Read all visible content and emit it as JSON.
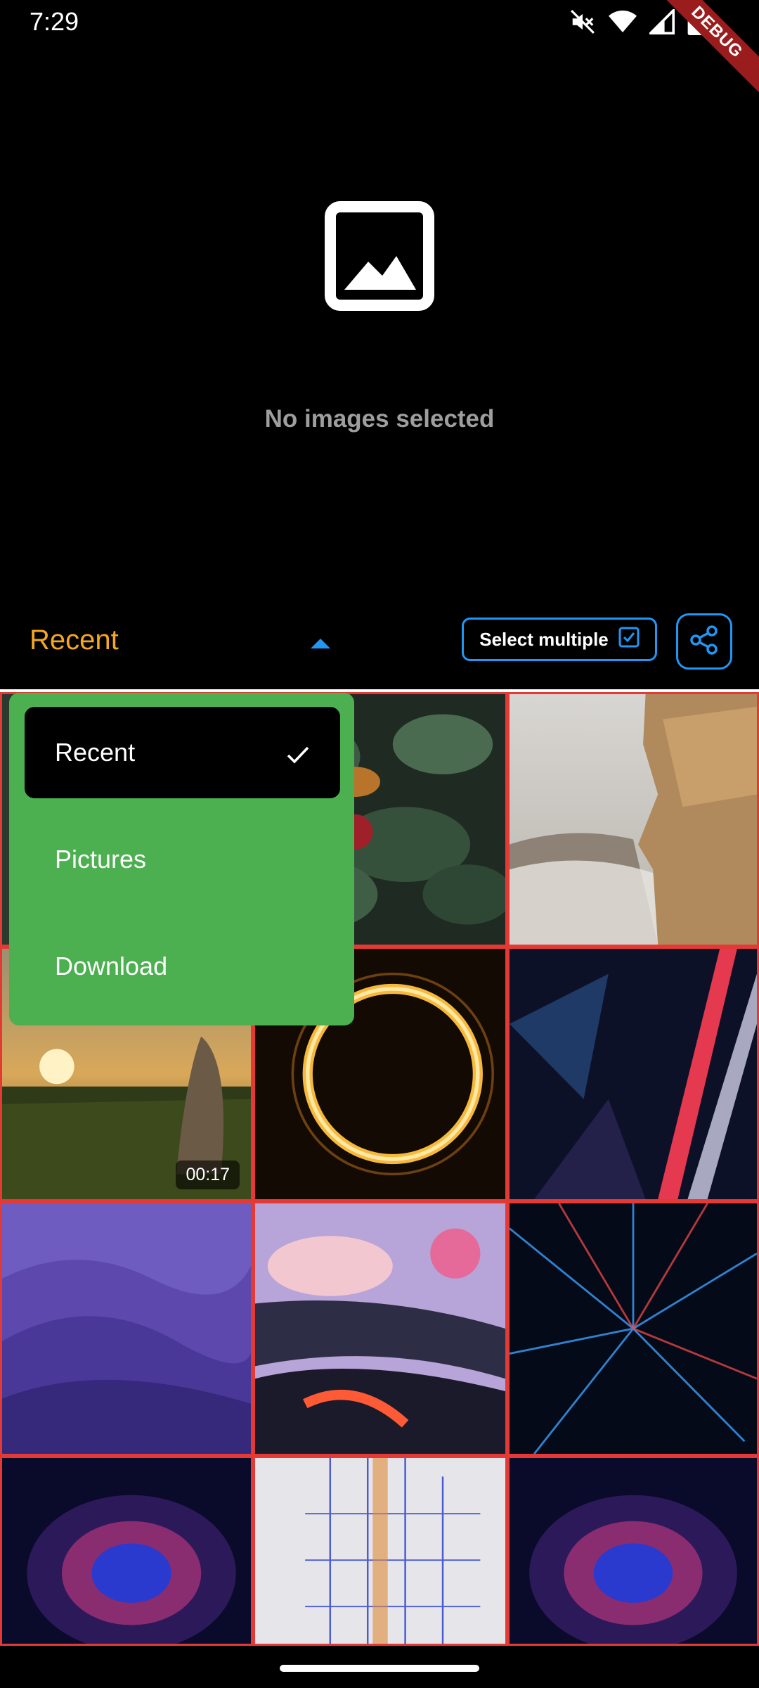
{
  "status_bar": {
    "time": "7:29",
    "icons": [
      "mute-icon",
      "wifi-icon",
      "signal-icon",
      "battery-icon"
    ]
  },
  "debug_banner": "DEBUG",
  "preview": {
    "icon": "image-placeholder-icon",
    "empty_text": "No images selected"
  },
  "toolbar": {
    "album_label": "Recent",
    "select_multiple_label": "Select multiple",
    "share_icon": "share-icon"
  },
  "dropdown": {
    "items": [
      {
        "label": "Recent",
        "selected": true
      },
      {
        "label": "Pictures",
        "selected": false
      },
      {
        "label": "Download",
        "selected": false
      }
    ]
  },
  "grid": {
    "duration_badge": "00:17"
  },
  "colors": {
    "accent_orange": "#f5a623",
    "accent_blue": "#2196f3",
    "dropdown_green": "#4caf50",
    "tile_border": "#e53935"
  }
}
